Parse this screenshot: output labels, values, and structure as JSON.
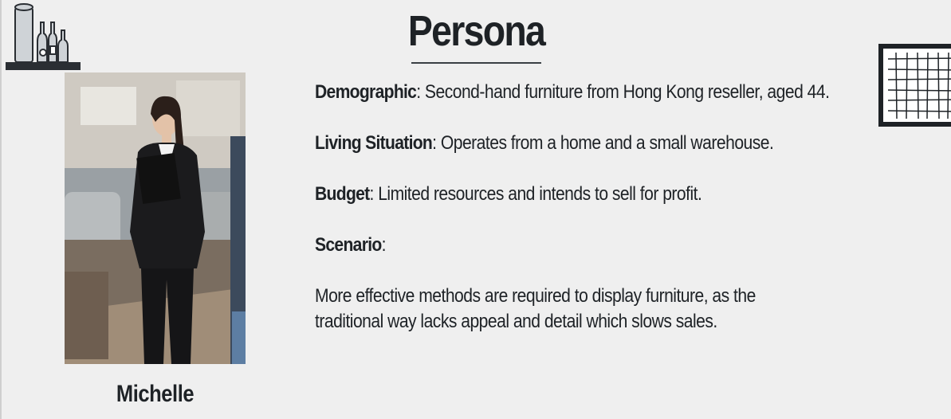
{
  "title": "Persona",
  "persona": {
    "name": "Michelle",
    "photo_icon": "woman-with-clipboard-photo"
  },
  "sections": [
    {
      "label": "Demographic",
      "separator": ": ",
      "text": "Second-hand furniture from Hong Kong reseller, aged 44."
    },
    {
      "label": "Living Situation",
      "separator": ": ",
      "text": "Operates from a home and a small warehouse."
    },
    {
      "label": "Budget",
      "separator": ": ",
      "text": "Limited resources and intends to sell for profit."
    },
    {
      "label": "Scenario",
      "separator": ":",
      "text": ""
    }
  ],
  "scenario_body": "More effective methods are required to display furniture, as the traditional way lacks appeal and detail which slows sales.",
  "decorations": {
    "top_left": "shelf-with-bottles-icon",
    "top_right": "grid-frame-icon"
  }
}
